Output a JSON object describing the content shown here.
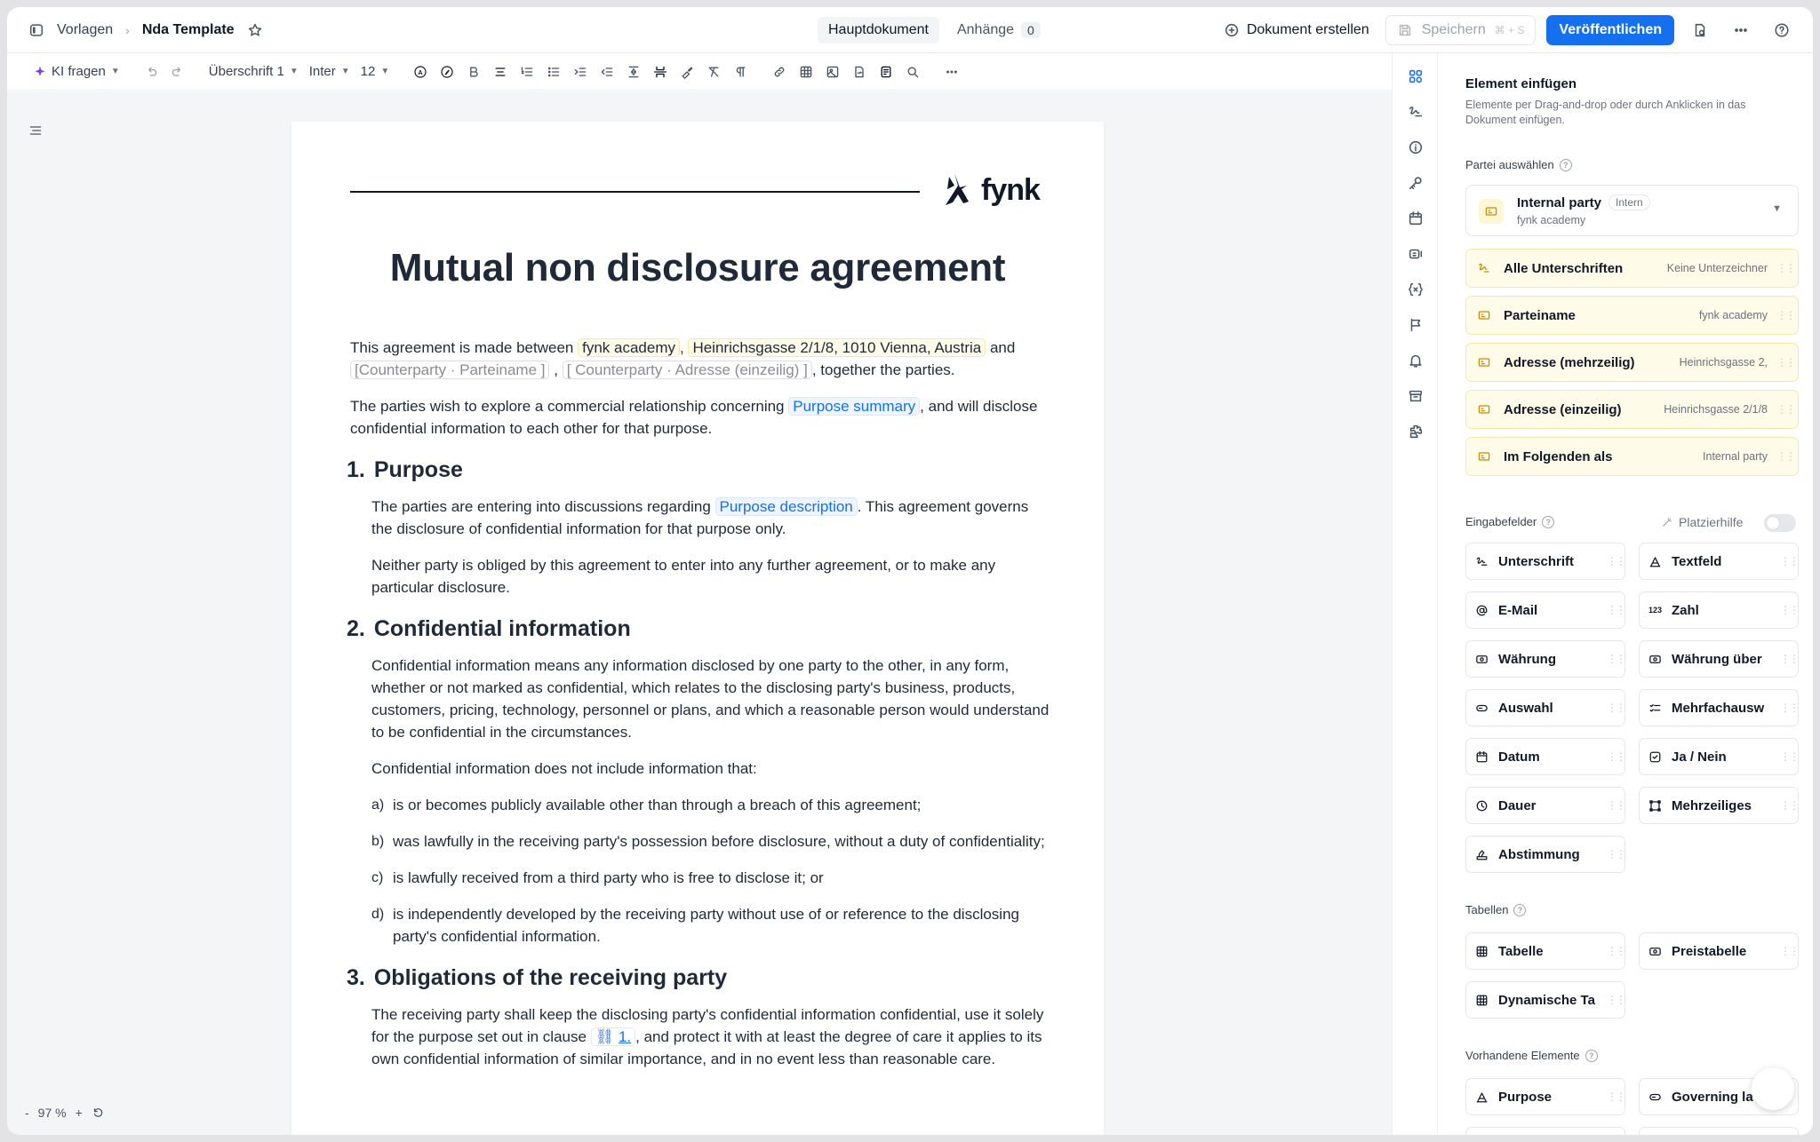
{
  "topbar": {
    "breadcrumb": [
      "Vorlagen",
      "Nda Template"
    ],
    "tabs": [
      {
        "label": "Hauptdokument"
      },
      {
        "label": "Anhänge",
        "count": "0"
      }
    ],
    "create_doc": "Dokument erstellen",
    "save": "Speichern",
    "save_shortcut": "⌘ + S",
    "publish": "Veröffentlichen"
  },
  "toolbar": {
    "ai": "KI fragen",
    "style": "Überschrift 1",
    "font": "Inter",
    "size": "12"
  },
  "zoom": {
    "minus": "-",
    "value": "97 %",
    "plus": "+"
  },
  "doc": {
    "logo": "fynk",
    "title": "Mutual non disclosure agreement",
    "p1_a": "This agreement is made between ",
    "p1_party": "fynk academy",
    "p1_sep": ",",
    "p1_addr": "Heinrichsgasse 2/1/8, 1010 Vienna, Austria",
    "p1_and": " and",
    "p1_cp_name": "[Counterparty · Parteiname ]",
    "p1_sep2": ",",
    "p1_cp_addr": "[ Counterparty · Adresse (einzeilig) ]",
    "p1_end": ", together the parties.",
    "p2_a": "The parties wish to explore a commercial relationship concerning ",
    "p2_field": "Purpose summary",
    "p2_b": ", and will disclose confidential information to each other for that purpose.",
    "s1_num": "1.",
    "s1_title": "Purpose",
    "s1_p1_a": "The parties are entering into discussions regarding ",
    "s1_p1_field": "Purpose description",
    "s1_p1_b": ". This agreement governs the disclosure of confidential information for that purpose only.",
    "s1_p2": "Neither party is obliged by this agreement to enter into any further agreement, or to make any particular disclosure.",
    "s2_num": "2.",
    "s2_title": "Confidential information",
    "s2_p1": "Confidential information means any information disclosed by one party to the other, in any form, whether or not marked as confidential, which relates to the disclosing party's business, products, customers, pricing, technology, personnel or plans, and which a reasonable person would understand to be confidential in the circumstances.",
    "s2_p2": "Confidential information does not include information that:",
    "s2_list": [
      {
        "m": "a)",
        "t": "is or becomes publicly available other than through a breach of this agreement;"
      },
      {
        "m": "b)",
        "t": "was lawfully in the receiving party's possession before disclosure, without a duty of confidentiality;"
      },
      {
        "m": "c)",
        "t": "is lawfully received from a third party who is free to disclose it; or"
      },
      {
        "m": "d)",
        "t": "is independently developed by the receiving party without use of or reference to the disclosing party's confidential information."
      }
    ],
    "s3_num": "3.",
    "s3_title": "Obligations of the receiving party",
    "s3_p1_a": "The receiving party shall keep the disclosing party's confidential information confidential, use it solely for the purpose set out in clause ",
    "s3_p1_ref": "1.",
    "s3_p1_b": ", and protect it with at least the degree of care it applies to its own confidential information of similar importance, and in no event less than reasonable care."
  },
  "panel": {
    "title": "Element einfügen",
    "subtitle": "Elemente per Drag-and-drop oder durch Anklicken in das Dokument einfügen.",
    "party_section": "Partei auswählen",
    "party_name": "Internal party",
    "party_tag": "Intern",
    "party_sub": "fynk academy",
    "party_fields": [
      {
        "label": "Alle Unterschriften",
        "value": "Keine Unterzeichner",
        "icon": "signature-icon"
      },
      {
        "label": "Parteiname",
        "value": "fynk academy",
        "icon": "party-field-icon"
      },
      {
        "label": "Adresse (mehrzeilig)",
        "value": "Heinrichsgasse 2,",
        "icon": "party-field-icon"
      },
      {
        "label": "Adresse (einzeilig)",
        "value": "Heinrichsgasse 2/1/8",
        "icon": "party-field-icon"
      },
      {
        "label": "Im Folgenden als",
        "value": "Internal party",
        "icon": "party-field-icon"
      }
    ],
    "input_section": "Eingabefelder",
    "placeholder_help": "Platzierhilfe",
    "inputs": [
      {
        "label": "Unterschrift",
        "icon": "signature-icon"
      },
      {
        "label": "Textfeld",
        "icon": "text-field-icon"
      },
      {
        "label": "E-Mail",
        "icon": "at-icon"
      },
      {
        "label": "Zahl",
        "icon": "number-icon"
      },
      {
        "label": "Währung",
        "icon": "currency-icon"
      },
      {
        "label": "Währung über",
        "icon": "currency-icon"
      },
      {
        "label": "Auswahl",
        "icon": "select-icon"
      },
      {
        "label": "Mehrfachausw",
        "icon": "multi-select-icon"
      },
      {
        "label": "Datum",
        "icon": "calendar-icon"
      },
      {
        "label": "Ja / Nein",
        "icon": "checkbox-icon"
      },
      {
        "label": "Dauer",
        "icon": "clock-icon"
      },
      {
        "label": "Mehrzeiliges",
        "icon": "textarea-icon"
      },
      {
        "label": "Abstimmung",
        "icon": "vote-icon"
      }
    ],
    "tables_section": "Tabellen",
    "tables": [
      {
        "label": "Tabelle",
        "icon": "table-icon"
      },
      {
        "label": "Preistabelle",
        "icon": "currency-icon"
      },
      {
        "label": "Dynamische Ta",
        "icon": "table-icon"
      }
    ],
    "existing_section": "Vorhandene Elemente",
    "existing": [
      {
        "label": "Purpose",
        "icon": "text-field-icon"
      },
      {
        "label": "Governing la",
        "icon": "select-icon"
      }
    ]
  }
}
